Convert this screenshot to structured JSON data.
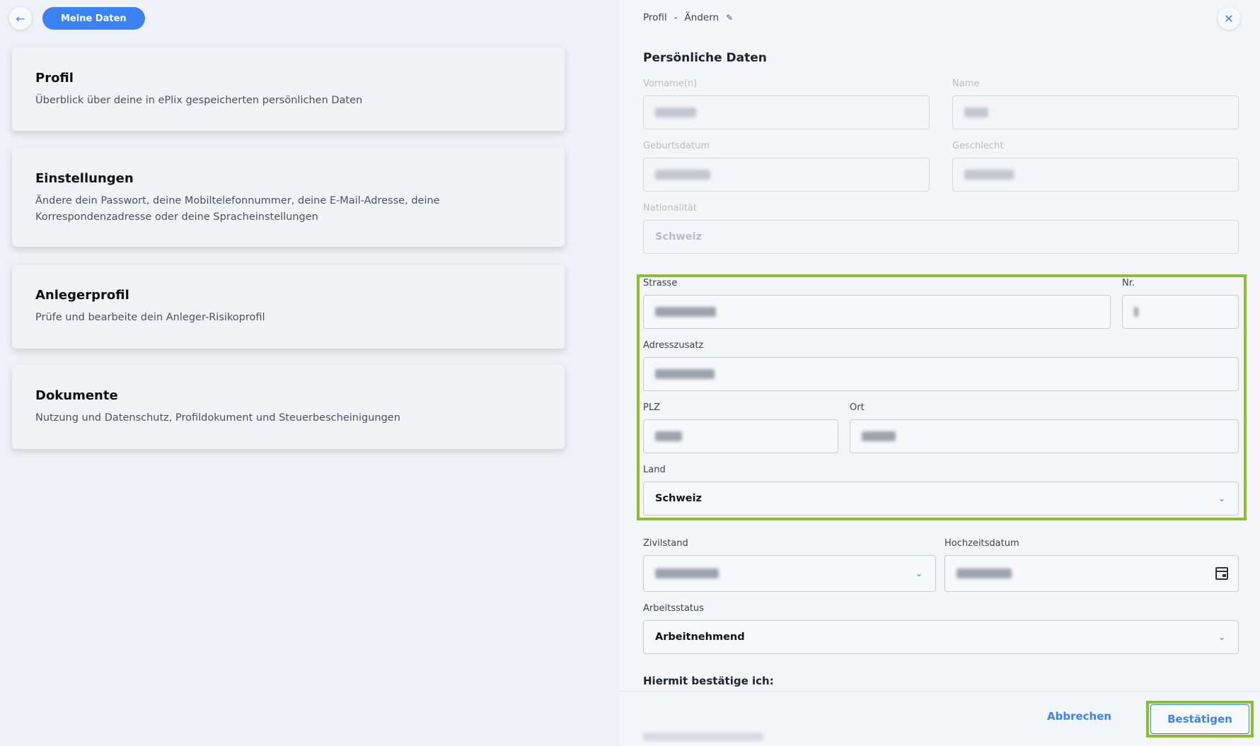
{
  "nav": {
    "back_icon": "arrow-left-icon",
    "pill_label": "Meine Daten"
  },
  "cards": [
    {
      "title": "Profil",
      "desc": "Überblick über deine in ePlix gespeicherten persönlichen Daten"
    },
    {
      "title": "Einstellungen",
      "desc": "Ändere dein Passwort, deine Mobiltelefonnummer, deine E-Mail-Adresse, deine Korrespondenzadresse oder deine Spracheinstellungen"
    },
    {
      "title": "Anlegerprofil",
      "desc": "Prüfe und bearbeite dein Anleger-Risikoprofil"
    },
    {
      "title": "Dokumente",
      "desc": "Nutzung und Datenschutz, Profildokument und Steuerbescheinigungen"
    }
  ],
  "panel": {
    "crumb_1": "Profil",
    "crumb_sep": "-",
    "crumb_2": "Ändern",
    "edit_icon": "pencil-icon",
    "close_icon": "close-icon",
    "section_title": "Persönliche Daten",
    "fields": {
      "vorname": {
        "label": "Vorname(n)"
      },
      "name": {
        "label": "Name"
      },
      "geburtsdatum": {
        "label": "Geburtsdatum"
      },
      "geschlecht": {
        "label": "Geschlecht"
      },
      "nationalitaet": {
        "label": "Nationalität",
        "value": "Schweiz"
      },
      "strasse": {
        "label": "Strasse"
      },
      "nr": {
        "label": "Nr."
      },
      "adresszusatz": {
        "label": "Adresszusatz"
      },
      "plz": {
        "label": "PLZ"
      },
      "ort": {
        "label": "Ort"
      },
      "land": {
        "label": "Land",
        "value": "Schweiz"
      },
      "zivilstand": {
        "label": "Zivilstand"
      },
      "hochzeitsdatum": {
        "label": "Hochzeitsdatum"
      },
      "arbeitsstatus": {
        "label": "Arbeitsstatus",
        "value": "Arbeitnehmend"
      }
    },
    "confirm_heading": "Hiermit bestätige ich:",
    "cancel_label": "Abbrechen",
    "confirm_label": "Bestätigen"
  },
  "colors": {
    "accent": "#3b82f6",
    "highlight": "#8cbd2e",
    "background": "#eef1f5"
  }
}
